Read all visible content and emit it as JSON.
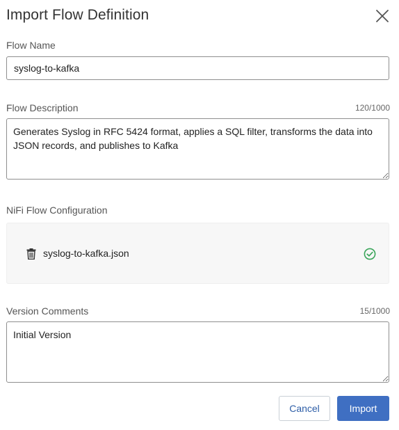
{
  "dialog": {
    "title": "Import Flow Definition"
  },
  "flow_name": {
    "label": "Flow Name",
    "value": "syslog-to-kafka"
  },
  "flow_description": {
    "label": "Flow Description",
    "counter": "120/1000",
    "value": "Generates Syslog in RFC 5424 format, applies a SQL filter, transforms the data into JSON records, and publishes to Kafka"
  },
  "nifi_config": {
    "label": "NiFi Flow Configuration",
    "file_name": "syslog-to-kafka.json",
    "status_color": "#3aa55a"
  },
  "version_comments": {
    "label": "Version Comments",
    "counter": "15/1000",
    "value": "Initial Version"
  },
  "buttons": {
    "cancel": "Cancel",
    "import": "Import"
  },
  "colors": {
    "primary": "#3f6fc2",
    "success": "#3aa55a"
  },
  "icons": {
    "close": "close-icon",
    "trash": "trash-icon",
    "check": "check-circle-icon"
  }
}
